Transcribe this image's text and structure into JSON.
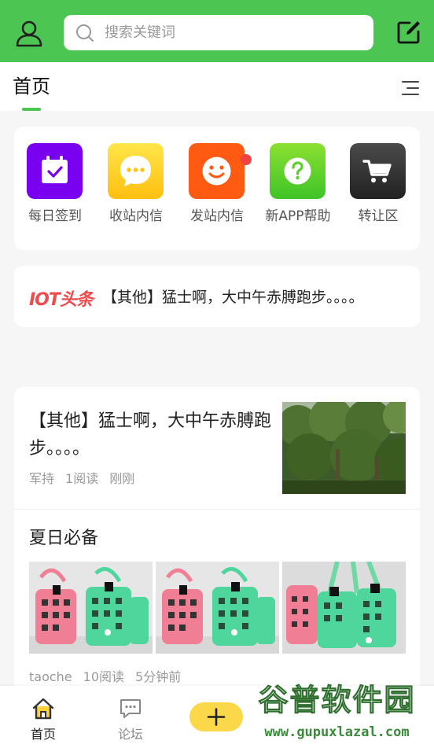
{
  "header": {
    "search_placeholder": "搜索关键词"
  },
  "titlebar": {
    "title": "首页"
  },
  "quick_links": [
    {
      "label": "每日签到",
      "icon": "calendar-check-icon",
      "color": "#7a00f0"
    },
    {
      "label": "收站内信",
      "icon": "chat-bubble-icon",
      "color": "#ffc816"
    },
    {
      "label": "发站内信",
      "icon": "smiley-icon",
      "color": "#ff5a12",
      "badge": true
    },
    {
      "label": "新APP帮助",
      "icon": "question-icon",
      "color": "#5cd12a"
    },
    {
      "label": "转让区",
      "icon": "cart-icon",
      "color": "#333333"
    }
  ],
  "headline": {
    "logo_text": "IOT头条",
    "text": "【其他】猛士啊，大中午赤膊跑步。。。。"
  },
  "feed": {
    "post1": {
      "title": "【其他】猛士啊，大中午赤膊跑步。。。。",
      "author": "军持",
      "reads": "1阅读",
      "time": "刚刚"
    },
    "post2": {
      "title": "夏日必备",
      "author": "taoche",
      "reads": "10阅读",
      "time": "5分钟前"
    }
  },
  "bottom_nav": {
    "home_label": "首页",
    "forum_label": "论坛",
    "post_label": "+"
  },
  "watermark": {
    "title": "谷普软件园",
    "url": "www.gupuxlazal.com"
  },
  "colors": {
    "brand_green": "#4cc553",
    "active_tab": "#4cc553",
    "notification_dot": "#f04444",
    "post_button": "#fbd84a"
  }
}
